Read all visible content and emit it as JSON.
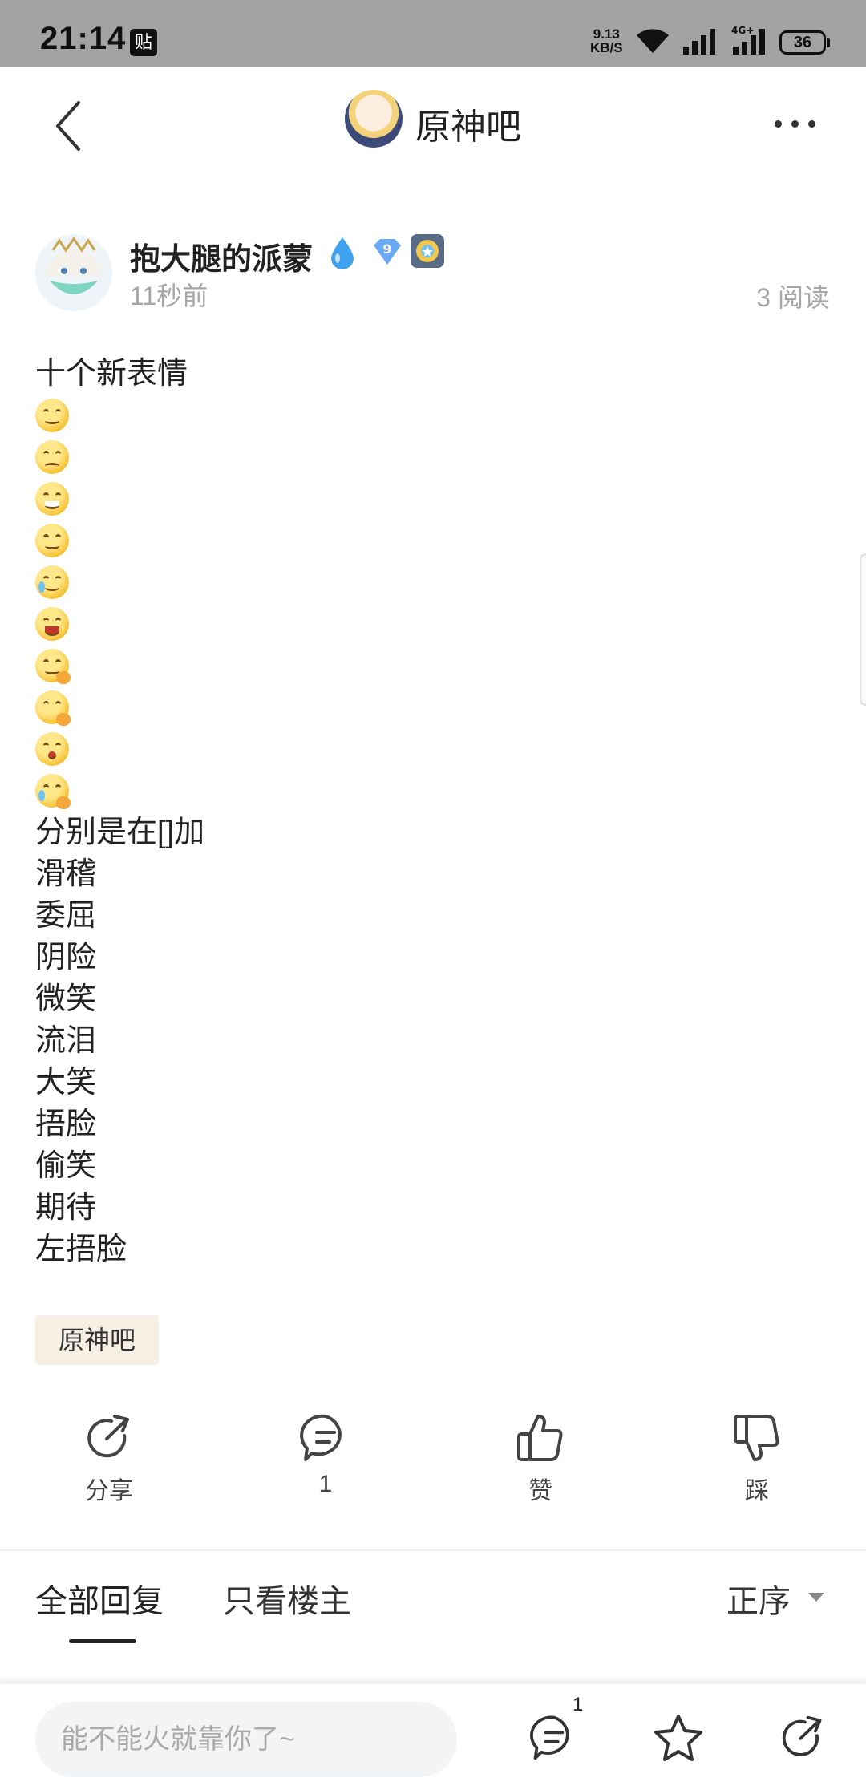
{
  "status_bar": {
    "time": "21:14",
    "app_badge": "贴",
    "speed_value": "9.13",
    "speed_unit": "KB/S",
    "battery": "36"
  },
  "header": {
    "forum_name": "原神吧",
    "back_icon": "chevron-left-icon",
    "more_icon": "more-dots-icon"
  },
  "post": {
    "author": "抱大腿的派蒙",
    "level": "9",
    "time": "11秒前",
    "read_count": "3 阅读",
    "title_line": "十个新表情",
    "emoji_count": 10,
    "intro_line": "分别是在[]加",
    "names": [
      "滑稽",
      "委屈",
      "阴险",
      "微笑",
      "流泪",
      "大笑",
      "捂脸",
      "偷笑",
      "期待",
      "左捂脸"
    ],
    "tag": "原神吧"
  },
  "actions": {
    "share": "分享",
    "comment": "1",
    "like": "赞",
    "dislike": "踩"
  },
  "replies": {
    "tab_all": "全部回复",
    "tab_owner": "只看楼主",
    "sort": "正序"
  },
  "bottom_bar": {
    "placeholder": "能不能火就靠你了~",
    "comment_badge": "1"
  },
  "colors": {
    "status_bar_bg": "#a3a3a3",
    "tag_bg": "#f7efe4",
    "muted_text": "#a6a6a6"
  }
}
